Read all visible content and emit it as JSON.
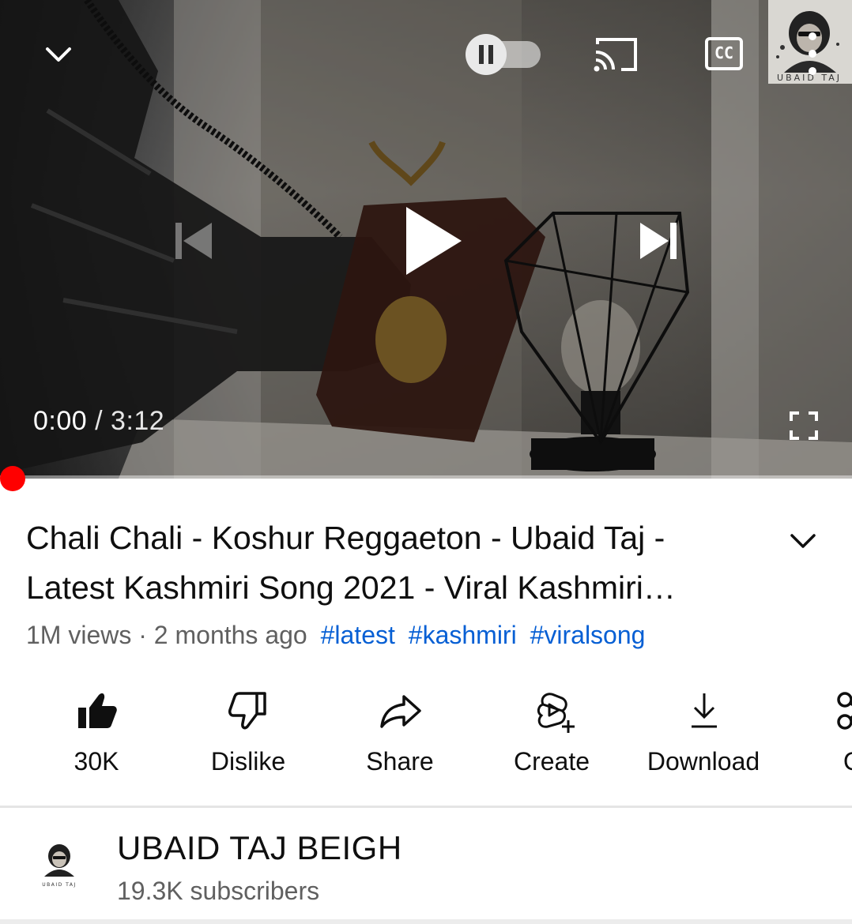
{
  "player": {
    "current_time": "0:00",
    "separator": "/",
    "duration": "3:12",
    "autoplay_on": false,
    "progress_fraction": 0.0,
    "watermark_text": "UBAID TAJ",
    "icons": [
      "collapse-icon",
      "autoplay-pause-icon",
      "cast-icon",
      "captions-icon",
      "more-icon",
      "previous-icon",
      "play-icon",
      "next-icon",
      "fullscreen-icon"
    ],
    "captions_label": "CC"
  },
  "video": {
    "title": "Chali Chali - Koshur Reggaeton - Ubaid Taj - Latest Kashmiri Song 2021 - Viral Kashmiri…",
    "views": "1M views",
    "dot": "·",
    "age": "2 months ago",
    "hashtags": [
      "#latest",
      "#kashmiri",
      "#viralsong"
    ]
  },
  "actions": [
    {
      "icon": "like-icon",
      "label": "30K"
    },
    {
      "icon": "dislike-icon",
      "label": "Dislike"
    },
    {
      "icon": "share-icon",
      "label": "Share"
    },
    {
      "icon": "create-icon",
      "label": "Create"
    },
    {
      "icon": "download-icon",
      "label": "Download"
    },
    {
      "icon": "clip-icon",
      "label": "Cl"
    }
  ],
  "channel": {
    "name": "UBAID TAJ BEIGH",
    "subscribers": "19.3K subscribers",
    "avatar_text": "UBAID TAJ"
  },
  "colors": {
    "accent_red": "#ff0000",
    "hashtag_blue": "#065fd4",
    "meta_gray": "#606060"
  }
}
